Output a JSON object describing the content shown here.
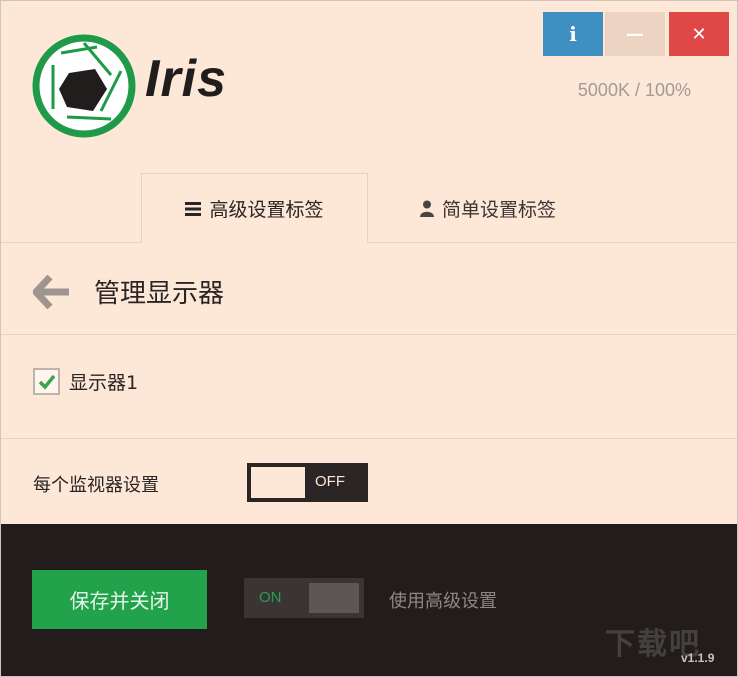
{
  "app": {
    "name": "Iris",
    "status": "5000K / 100%",
    "version": "v1.1.9"
  },
  "window_buttons": {
    "info": "i",
    "minimize": "—",
    "close": "✕"
  },
  "tabs": [
    {
      "label": "高级设置标签",
      "icon": "menu-icon",
      "active": true
    },
    {
      "label": "简单设置标签",
      "icon": "user-icon",
      "active": false
    }
  ],
  "section": {
    "title": "管理显示器"
  },
  "monitors": [
    {
      "label": "显示器1",
      "checked": true
    }
  ],
  "per_monitor": {
    "label": "每个监视器设置",
    "toggle_state": "OFF"
  },
  "footer": {
    "save_label": "保存并关闭",
    "advanced_toggle_state": "ON",
    "advanced_label": "使用高级设置"
  },
  "watermark": "下载吧",
  "colors": {
    "background": "#fde7d6",
    "footer": "#221c1c",
    "accent_green": "#22a24b",
    "info_blue": "#3e8fc2",
    "close_red": "#e04747"
  }
}
